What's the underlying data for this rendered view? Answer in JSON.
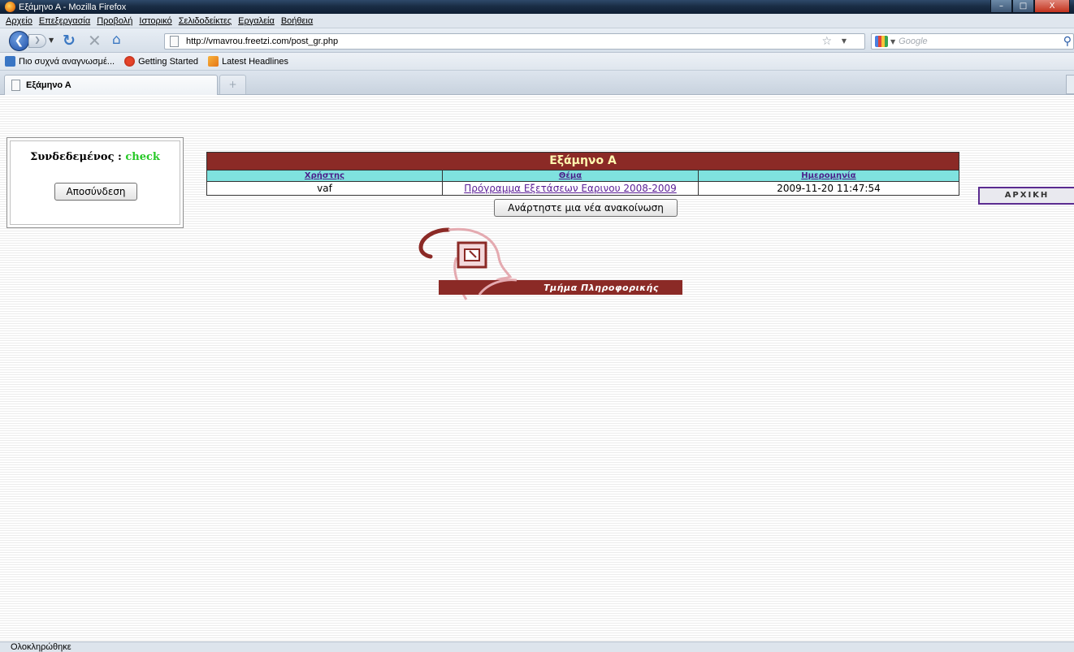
{
  "window": {
    "title": "Εξάμηνο Α - Mozilla Firefox",
    "buttons": {
      "minimize": "–",
      "maximize": "□",
      "close": "X"
    }
  },
  "menu": [
    "Αρχείο",
    "Επεξεργασία",
    "Προβολή",
    "Ιστορικό",
    "Σελιδοδείκτες",
    "Εργαλεία",
    "Βοήθεια"
  ],
  "nav": {
    "url": "http://vmavrou.freetzi.com/post_gr.php",
    "search_placeholder": "Google"
  },
  "bookmarks": [
    "Πιο συχνά αναγνωσμέ...",
    "Getting Started",
    "Latest Headlines"
  ],
  "tabs": [
    {
      "label": "Εξάμηνο Α"
    }
  ],
  "page": {
    "login": {
      "prefix": "Συνδεδεμένος : ",
      "username": "check",
      "logout_button": "Αποσύνδεση"
    },
    "posts_table": {
      "title": "Εξάμηνο Α",
      "columns": [
        "Χρήστης",
        "Θέμα",
        "Ημερομηνία"
      ],
      "rows": [
        {
          "user": "vaf",
          "subject": "Πρόγραμμα Εξετάσεων Εαρινου 2008-2009",
          "date": "2009-11-20 11:47:54"
        }
      ]
    },
    "new_post_button": "Ανάρτηστε μια νέα ανακοίνωση",
    "home_link": "ΑΡΧΙΚΗ",
    "logo_text": "Τμήμα Πληροφορικής"
  },
  "status": "Ολοκληρώθηκε",
  "colors": {
    "table_title_bg": "#8b2a26",
    "table_header_bg": "#7fe2df",
    "username_green": "#27c927",
    "link_purple": "#5a1d96"
  }
}
